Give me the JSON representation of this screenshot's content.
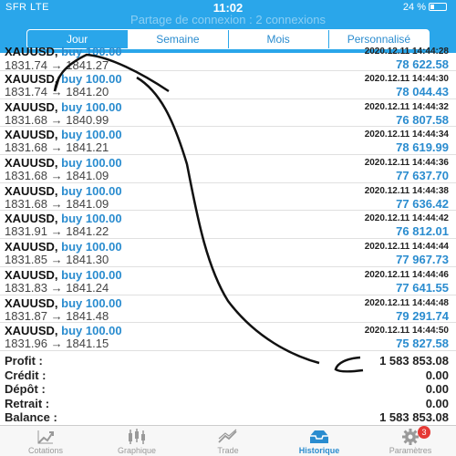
{
  "status_bar": {
    "carrier": "SFR  LTE",
    "time": "11:02",
    "battery": "24 %"
  },
  "header": {
    "subtitle": "Partage de connexion : 2 connexions"
  },
  "segments": [
    "Jour",
    "Semaine",
    "Mois",
    "Personnalisé"
  ],
  "trades": [
    {
      "symbol": "XAUUSD,",
      "side": "buy 100.00",
      "open": "1831.74",
      "close": "1841.27",
      "date": "2020.12.11 14:44:28",
      "profit": "78 622.58"
    },
    {
      "symbol": "XAUUSD,",
      "side": "buy 100.00",
      "open": "1831.74",
      "close": "1841.20",
      "date": "2020.12.11 14:44:30",
      "profit": "78 044.43"
    },
    {
      "symbol": "XAUUSD,",
      "side": "buy 100.00",
      "open": "1831.68",
      "close": "1840.99",
      "date": "2020.12.11 14:44:32",
      "profit": "76 807.58"
    },
    {
      "symbol": "XAUUSD,",
      "side": "buy 100.00",
      "open": "1831.68",
      "close": "1841.21",
      "date": "2020.12.11 14:44:34",
      "profit": "78 619.99"
    },
    {
      "symbol": "XAUUSD,",
      "side": "buy 100.00",
      "open": "1831.68",
      "close": "1841.09",
      "date": "2020.12.11 14:44:36",
      "profit": "77 637.70"
    },
    {
      "symbol": "XAUUSD,",
      "side": "buy 100.00",
      "open": "1831.68",
      "close": "1841.09",
      "date": "2020.12.11 14:44:38",
      "profit": "77 636.42"
    },
    {
      "symbol": "XAUUSD,",
      "side": "buy 100.00",
      "open": "1831.91",
      "close": "1841.22",
      "date": "2020.12.11 14:44:42",
      "profit": "76 812.01"
    },
    {
      "symbol": "XAUUSD,",
      "side": "buy 100.00",
      "open": "1831.85",
      "close": "1841.30",
      "date": "2020.12.11 14:44:44",
      "profit": "77 967.73"
    },
    {
      "symbol": "XAUUSD,",
      "side": "buy 100.00",
      "open": "1831.83",
      "close": "1841.24",
      "date": "2020.12.11 14:44:46",
      "profit": "77 641.55"
    },
    {
      "symbol": "XAUUSD,",
      "side": "buy 100.00",
      "open": "1831.87",
      "close": "1841.48",
      "date": "2020.12.11 14:44:48",
      "profit": "79 291.74"
    },
    {
      "symbol": "XAUUSD,",
      "side": "buy 100.00",
      "open": "1831.96",
      "close": "1841.15",
      "date": "2020.12.11 14:44:50",
      "profit": "75 827.58"
    }
  ],
  "arrow_glyph": "→",
  "summary": [
    {
      "label": "Profit :",
      "value": "1 583 853.08"
    },
    {
      "label": "Crédit :",
      "value": "0.00"
    },
    {
      "label": "Dépôt :",
      "value": "0.00"
    },
    {
      "label": "Retrait :",
      "value": "0.00"
    },
    {
      "label": "Balance :",
      "value": "1 583 853.08"
    }
  ],
  "tabs": [
    {
      "label": "Cotations",
      "icon": "cotations-icon"
    },
    {
      "label": "Graphique",
      "icon": "chart-icon"
    },
    {
      "label": "Trade",
      "icon": "trade-icon"
    },
    {
      "label": "Historique",
      "icon": "history-icon"
    },
    {
      "label": "Paramètres",
      "icon": "gear-icon",
      "badge": "3"
    }
  ],
  "colors": {
    "header": "#2aa6ea",
    "accent": "#2a8ccf",
    "badge": "#e53935"
  }
}
